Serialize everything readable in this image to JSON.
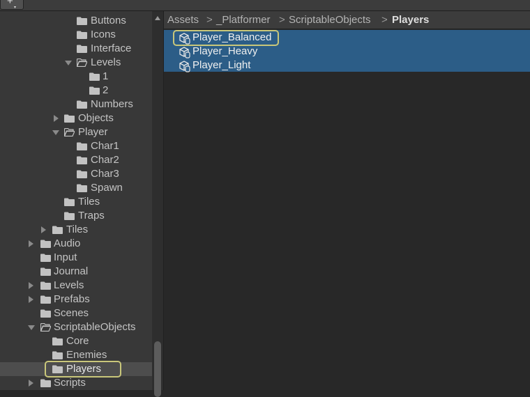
{
  "toolbar": {
    "add_label": "+",
    "add_caret": "▾"
  },
  "tree": {
    "items": [
      {
        "label": "Buttons",
        "arrow": "none"
      },
      {
        "label": "Icons",
        "arrow": "none"
      },
      {
        "label": "Interface",
        "arrow": "none"
      },
      {
        "label": "Levels",
        "arrow": "down"
      },
      {
        "label": "1",
        "arrow": "none"
      },
      {
        "label": "2",
        "arrow": "none"
      },
      {
        "label": "Numbers",
        "arrow": "none"
      },
      {
        "label": "Objects",
        "arrow": "right"
      },
      {
        "label": "Player",
        "arrow": "down"
      },
      {
        "label": "Char1",
        "arrow": "none"
      },
      {
        "label": "Char2",
        "arrow": "none"
      },
      {
        "label": "Char3",
        "arrow": "none"
      },
      {
        "label": "Spawn",
        "arrow": "none"
      },
      {
        "label": "Tiles",
        "arrow": "none"
      },
      {
        "label": "Traps",
        "arrow": "none"
      },
      {
        "label": "Tiles",
        "arrow": "right"
      },
      {
        "label": "Audio",
        "arrow": "right"
      },
      {
        "label": "Input",
        "arrow": "none"
      },
      {
        "label": "Journal",
        "arrow": "none"
      },
      {
        "label": "Levels",
        "arrow": "right"
      },
      {
        "label": "Prefabs",
        "arrow": "right"
      },
      {
        "label": "Scenes",
        "arrow": "none"
      },
      {
        "label": "ScriptableObjects",
        "arrow": "down"
      },
      {
        "label": "Core",
        "arrow": "none"
      },
      {
        "label": "Enemies",
        "arrow": "none"
      },
      {
        "label": "Players",
        "arrow": "none",
        "selected": true
      },
      {
        "label": "Scripts",
        "arrow": "right"
      }
    ]
  },
  "breadcrumb": {
    "items": [
      "Assets",
      "_Platformer",
      "ScriptableObjects",
      "Players"
    ],
    "separator": ">"
  },
  "assets": {
    "items": [
      {
        "label": "Player_Balanced",
        "icon": "scriptable-object-icon",
        "highlighted": true
      },
      {
        "label": "Player_Heavy",
        "icon": "scriptable-object-icon"
      },
      {
        "label": "Player_Light",
        "icon": "scriptable-object-icon"
      }
    ]
  },
  "colors": {
    "selection": "#2c5d87",
    "highlight_outline": "#c9c77a",
    "panel_bg": "#383838",
    "asset_bg": "#282828"
  }
}
